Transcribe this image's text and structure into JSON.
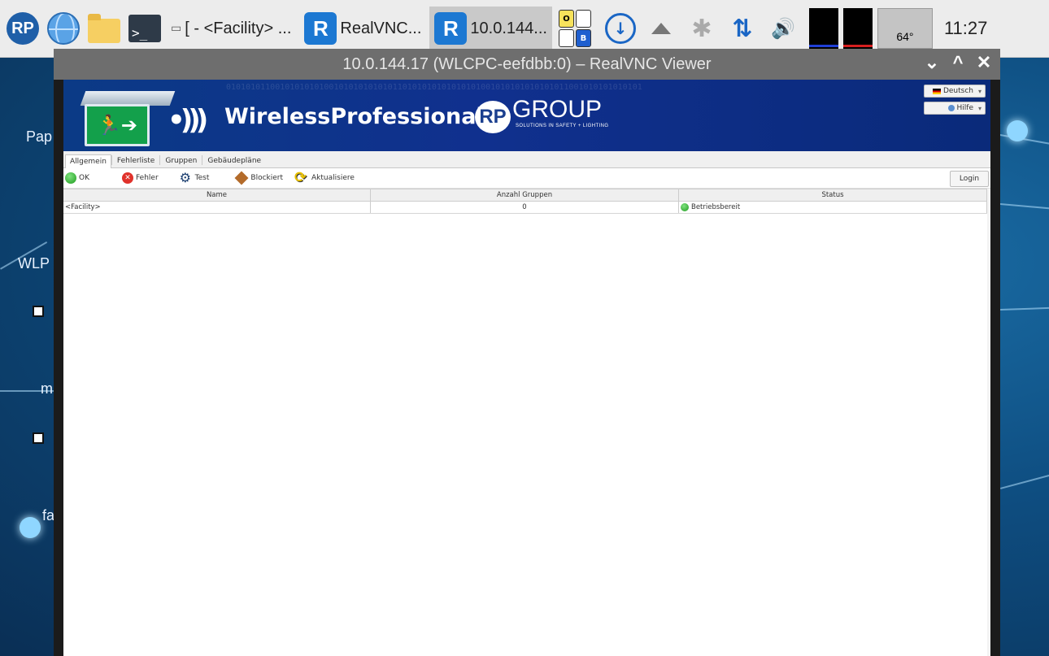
{
  "taskbar": {
    "tasks": [
      {
        "label": "[ - <Facility> ..."
      },
      {
        "label": "RealVNC..."
      },
      {
        "label": "10.0.144..."
      }
    ],
    "ob_indicator": {
      "o": "O",
      "b": "B"
    },
    "temperature": "64°",
    "clock": "11:27",
    "graph_colors": {
      "cpu": "#1f3fd6",
      "mem": "#d61f1f"
    }
  },
  "desktop": {
    "labels": [
      "Pap",
      "WLP",
      "m",
      "fa"
    ]
  },
  "vnc_window": {
    "title": "10.0.144.17 (WLCPC-eefdbb:0) – RealVNC Viewer"
  },
  "app": {
    "banner": {
      "brand": "WirelessProfessional",
      "group": "GROUP",
      "slogan": "SOLUTIONS IN SAFETY + LIGHTING",
      "language": "Deutsch",
      "help": "Hilfe"
    },
    "tabs": [
      {
        "label": "Allgemein",
        "active": true
      },
      {
        "label": "Fehlerliste",
        "active": false
      },
      {
        "label": "Gruppen",
        "active": false
      },
      {
        "label": "Gebäudepläne",
        "active": false
      }
    ],
    "toolbar": {
      "ok": "OK",
      "error": "Fehler",
      "test": "Test",
      "blocked": "Blockiert",
      "refresh": "Aktualisiere",
      "login": "Login"
    },
    "grid": {
      "columns": [
        "Name",
        "Anzahl Gruppen",
        "Status"
      ],
      "rows": [
        {
          "name": "<Facility>",
          "groups": "0",
          "status": "Betriebsbereit"
        }
      ]
    }
  }
}
